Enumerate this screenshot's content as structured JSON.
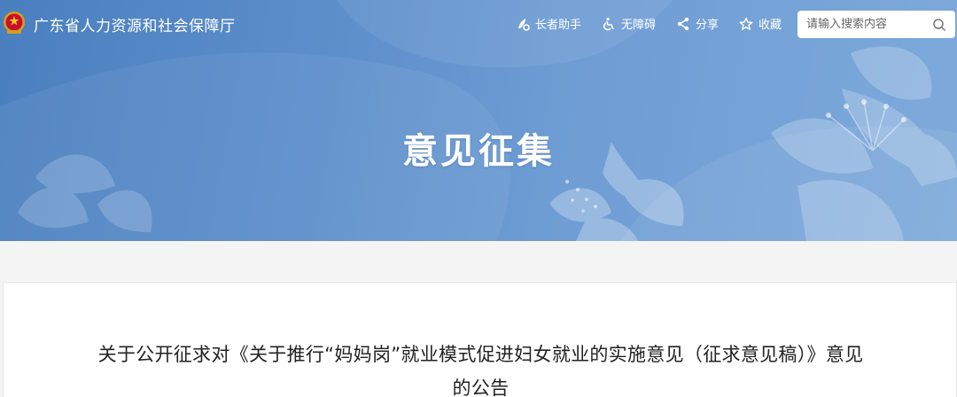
{
  "header": {
    "site_title": "广东省人力资源和社会保障厅",
    "tools": [
      {
        "label": "长者助手",
        "icon": "elder-assist-icon"
      },
      {
        "label": "无障碍",
        "icon": "accessibility-icon"
      },
      {
        "label": "分享",
        "icon": "share-icon"
      },
      {
        "label": "收藏",
        "icon": "star-icon"
      }
    ],
    "search": {
      "placeholder": "请输入搜索内容",
      "icon": "search-icon"
    }
  },
  "banner": {
    "title": "意见征集"
  },
  "article": {
    "title_line1": "关于公开征求对《关于推行“妈妈岗”就业模式促进妇女就业的实施意见（征求意见稿）》意见",
    "title_line2": "的公告"
  },
  "colors": {
    "banner": "#5d8fcb",
    "page_bg": "#f4f4f4"
  }
}
